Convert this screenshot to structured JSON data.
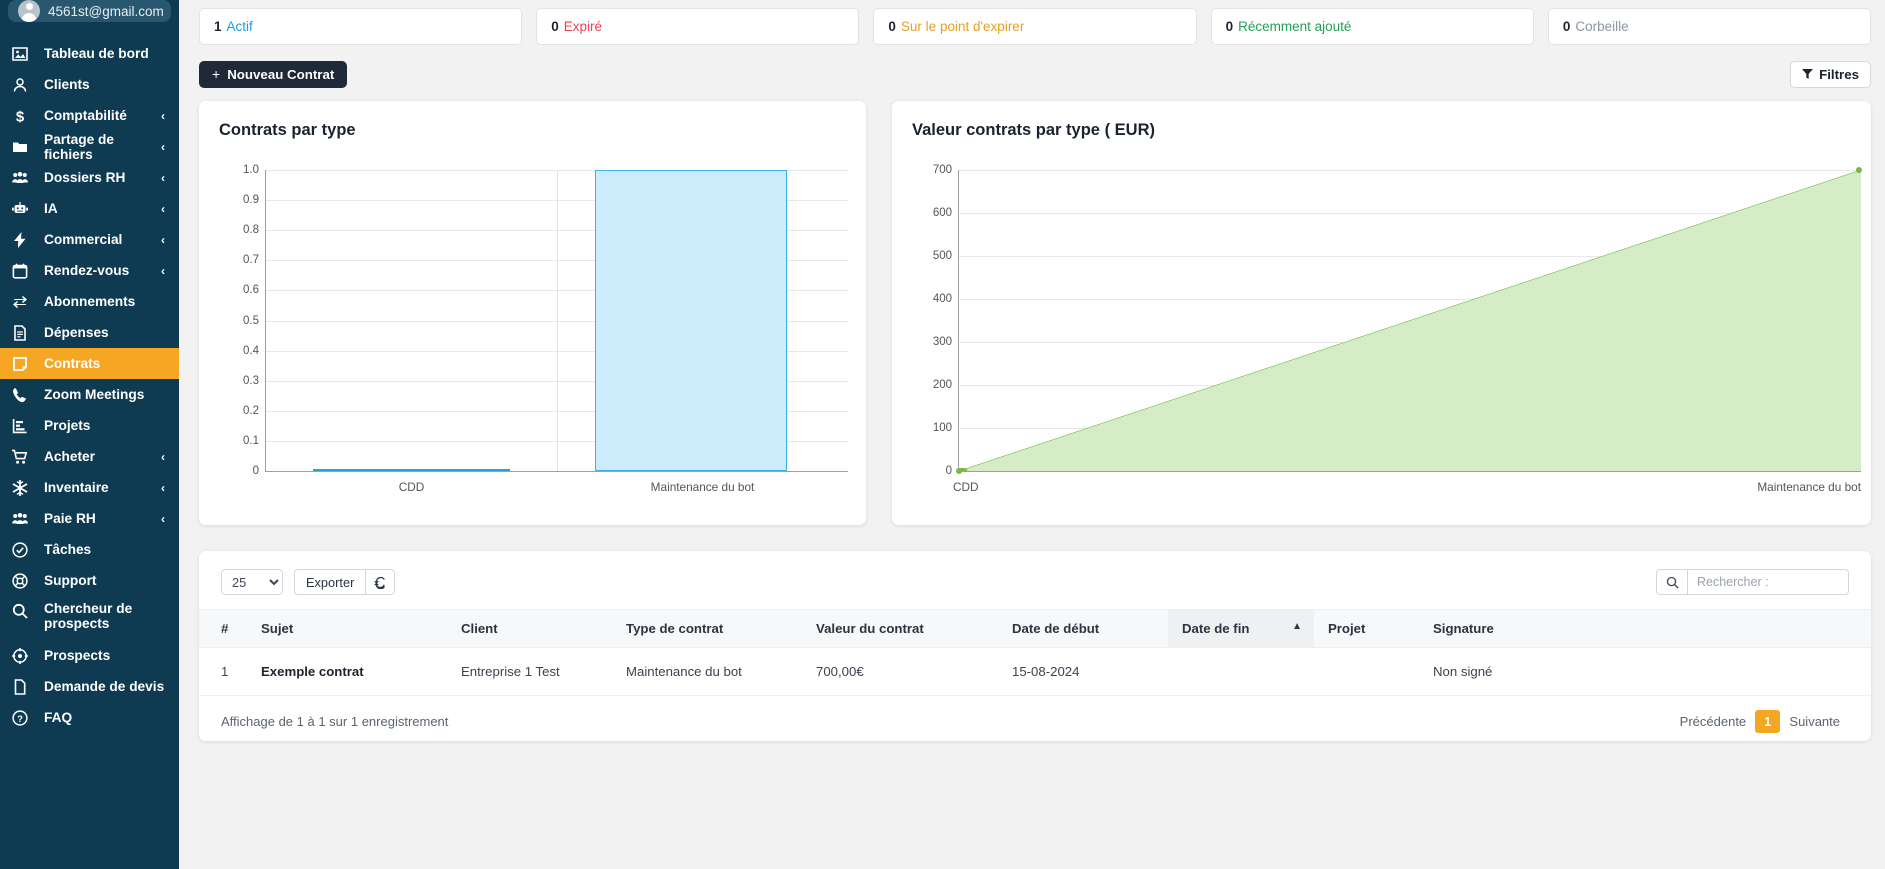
{
  "sidebar": {
    "user_email": "4561st@gmail.com",
    "items": [
      {
        "label": "Tableau de bord",
        "icon": "dashboard-icon",
        "chevron": false
      },
      {
        "label": "Clients",
        "icon": "user-icon",
        "chevron": false
      },
      {
        "label": "Comptabilité",
        "icon": "dollar-icon",
        "chevron": true
      },
      {
        "label": "Partage de fichiers",
        "icon": "folder-icon",
        "chevron": true
      },
      {
        "label": "Dossiers RH",
        "icon": "users-icon",
        "chevron": true
      },
      {
        "label": "IA",
        "icon": "robot-icon",
        "chevron": true
      },
      {
        "label": "Commercial",
        "icon": "bolt-icon",
        "chevron": true
      },
      {
        "label": "Rendez-vous",
        "icon": "calendar-icon",
        "chevron": true
      },
      {
        "label": "Abonnements",
        "icon": "refresh-cycle-icon",
        "chevron": false
      },
      {
        "label": "Dépenses",
        "icon": "document-icon",
        "chevron": false
      },
      {
        "label": "Contrats",
        "icon": "contract-icon",
        "chevron": false,
        "active": true
      },
      {
        "label": "Zoom Meetings",
        "icon": "phone-icon",
        "chevron": false
      },
      {
        "label": "Projets",
        "icon": "chart-bar-icon",
        "chevron": false
      },
      {
        "label": "Acheter",
        "icon": "cart-icon",
        "chevron": true
      },
      {
        "label": "Inventaire",
        "icon": "snowflake-icon",
        "chevron": true
      },
      {
        "label": "Paie RH",
        "icon": "users-icon",
        "chevron": true
      },
      {
        "label": "Tâches",
        "icon": "check-circle-icon",
        "chevron": false
      },
      {
        "label": "Support",
        "icon": "lifebuoy-icon",
        "chevron": false
      },
      {
        "label": "Chercheur de prospects",
        "icon": "search-icon",
        "chevron": false,
        "tall": true
      },
      {
        "label": "Prospects",
        "icon": "target-icon",
        "chevron": false
      },
      {
        "label": "Demande de devis",
        "icon": "page-icon",
        "chevron": false
      },
      {
        "label": "FAQ",
        "icon": "question-circle-icon",
        "chevron": false
      }
    ]
  },
  "stats": [
    {
      "count": "1",
      "label": "Actif",
      "color": "#1b9bdc"
    },
    {
      "count": "0",
      "label": "Expiré",
      "color": "#ef4156"
    },
    {
      "count": "0",
      "label": "Sur le point d'expirer",
      "color": "#e8a020"
    },
    {
      "count": "0",
      "label": "Récemment ajouté",
      "color": "#22a055"
    },
    {
      "count": "0",
      "label": "Corbeille",
      "color": "#8d96a0"
    }
  ],
  "toolbar": {
    "new_contract_label": "Nouveau Contrat",
    "new_contract_plus": "+",
    "filters_label": "Filtres"
  },
  "chart_data": [
    {
      "type": "bar",
      "title": "Contrats par type",
      "categories": [
        "CDD",
        "Maintenance du bot"
      ],
      "values": [
        0,
        1
      ],
      "xlabel": "",
      "ylabel": "",
      "ylim": [
        0,
        1.0
      ],
      "yticks": [
        "1.0",
        "0.9",
        "0.8",
        "0.7",
        "0.6",
        "0.5",
        "0.4",
        "0.3",
        "0.2",
        "0.1",
        "0"
      ],
      "grid": true,
      "legend": "none",
      "bar_fill": "#cdecfb",
      "bar_stroke": "#3ab0e8"
    },
    {
      "type": "area",
      "title": "Valeur contrats par type ( EUR)",
      "categories": [
        "CDD",
        "Maintenance du bot"
      ],
      "values": [
        0,
        700
      ],
      "xlabel": "",
      "ylabel": "",
      "ylim": [
        0,
        700
      ],
      "yticks": [
        "700",
        "600",
        "500",
        "400",
        "300",
        "200",
        "100",
        "0"
      ],
      "grid": true,
      "legend": "none",
      "area_fill": "#d5ecc6",
      "line_stroke": "#86c45a"
    }
  ],
  "table": {
    "page_length": "25",
    "page_length_options": [
      "25"
    ],
    "export_label": "Exporter",
    "refresh_icon": "refresh-icon",
    "search_placeholder": "Rechercher :",
    "search_value": "",
    "columns": [
      "#",
      "Sujet",
      "Client",
      "Type de contrat",
      "Valeur du contrat",
      "Date de début",
      "Date de fin",
      "Projet",
      "Signature"
    ],
    "sorted_column": "Date de fin",
    "sort_caret": "▲",
    "rows": [
      {
        "num": "1",
        "sujet": "Exemple contrat",
        "client": "Entreprise 1 Test",
        "type": "Maintenance du bot",
        "valeur": "700,00€",
        "date_debut": "15-08-2024",
        "date_fin": "",
        "projet": "",
        "signature": "Non signé"
      }
    ],
    "footer_info": "Affichage de 1 à 1 sur 1 enregistrement",
    "pagination": {
      "prev": "Précédente",
      "current": "1",
      "next": "Suivante"
    }
  }
}
